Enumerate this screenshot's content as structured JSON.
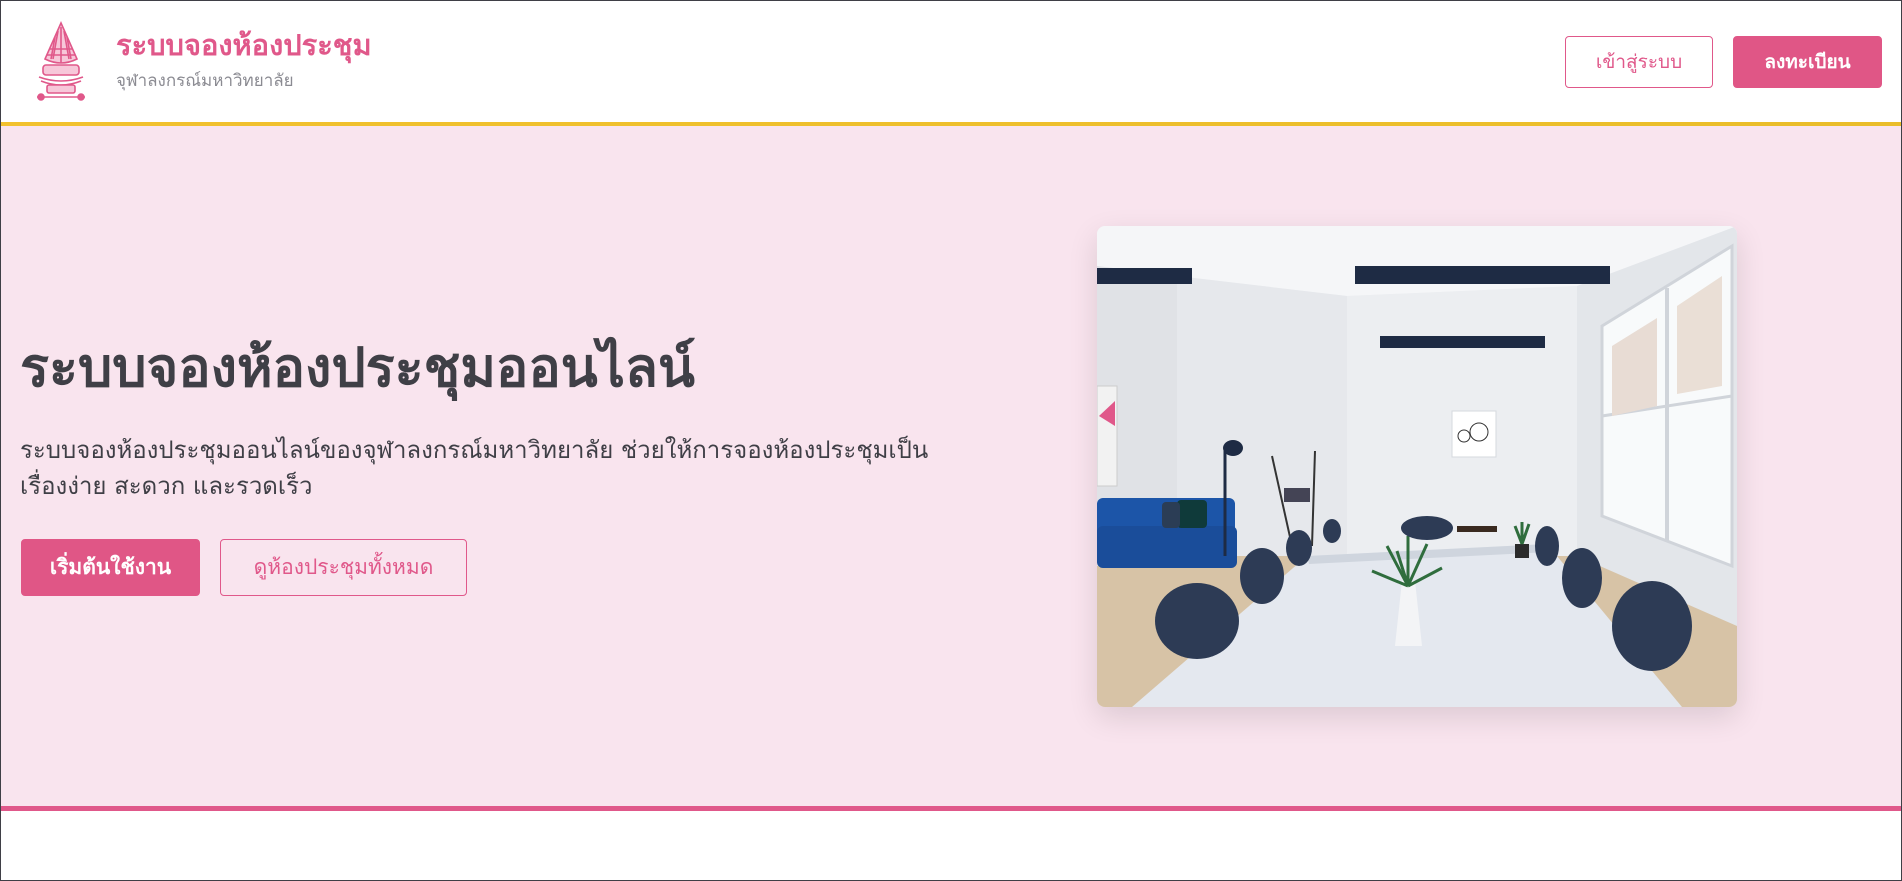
{
  "header": {
    "brand_title": "ระบบจองห้องประชุม",
    "brand_subtitle": "จุฬาลงกรณ์มหาวิทยาลัย",
    "logo_icon": "chula-crest-icon",
    "login_label": "เข้าสู่ระบบ",
    "register_label": "ลงทะเบียน"
  },
  "hero": {
    "title": "ระบบจองห้องประชุมออนไลน์",
    "description": "ระบบจองห้องประชุมออนไลน์ของจุฬาลงกรณ์มหาวิทยาลัย ช่วยให้การจองห้องประชุมเป็นเรื่องง่าย สะดวก และรวดเร็ว",
    "start_label": "เริ่มต้นใช้งาน",
    "view_rooms_label": "ดูห้องประชุมทั้งหมด",
    "image_subject": "meeting-room-photo"
  },
  "colors": {
    "brand_pink": "#e0588a",
    "hero_bg": "#f9e4ee",
    "accent_gold": "#f2c12e",
    "text_dark": "#3f3f46",
    "text_muted": "#8b8b92"
  }
}
